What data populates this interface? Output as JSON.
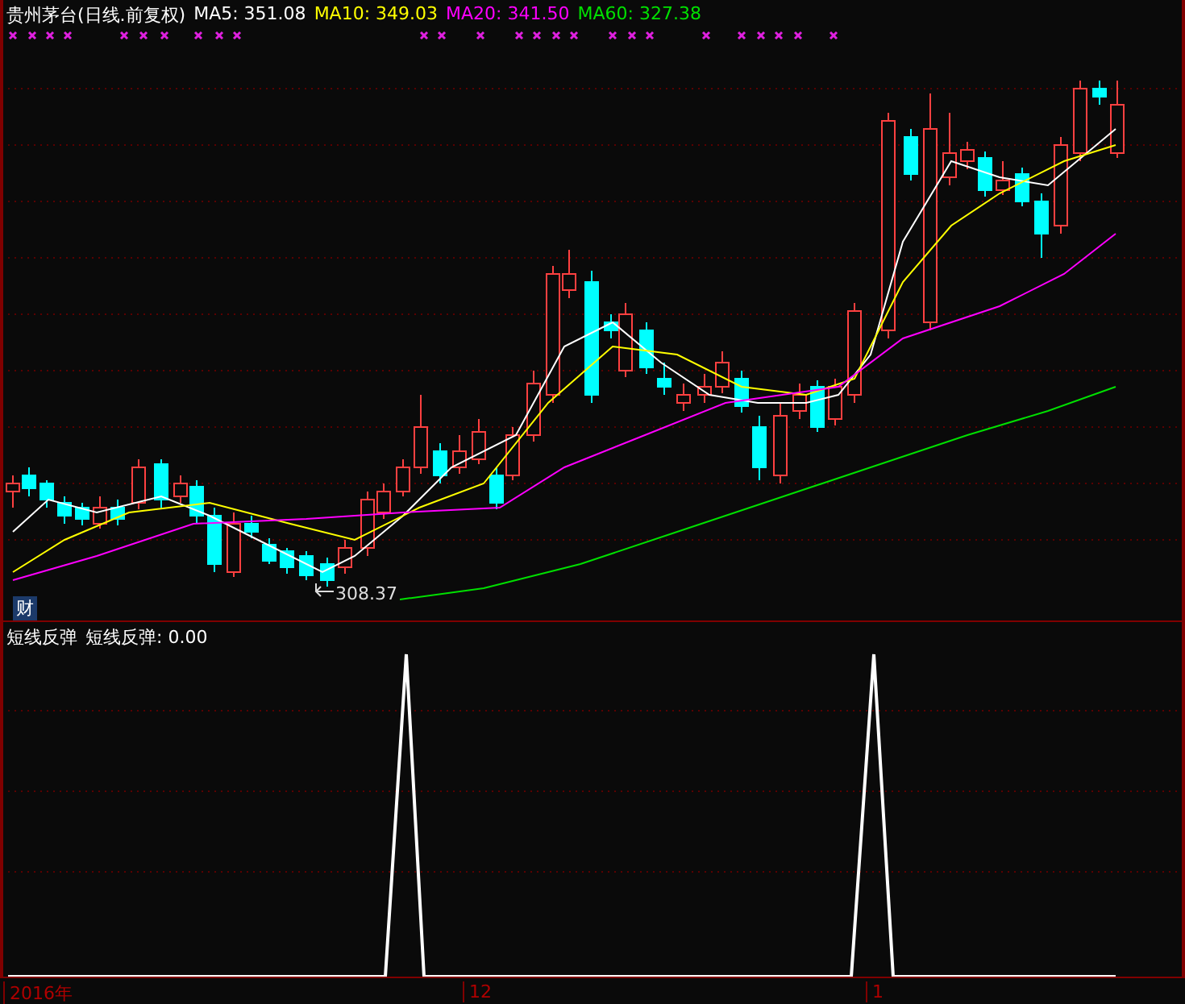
{
  "header": {
    "title": "贵州茅台(日线.前复权)",
    "indicators": [
      {
        "label": "MA5: 351.08",
        "color": "#ffffff"
      },
      {
        "label": "MA10: 349.03",
        "color": "#ffff00"
      },
      {
        "label": "MA20: 341.50",
        "color": "#ff00ff"
      },
      {
        "label": "MA60: 327.38",
        "color": "#00e000"
      }
    ]
  },
  "price_pane": {
    "low_label": "308.37",
    "badge": "财"
  },
  "indicator_pane": {
    "name": "短线反弹",
    "readout": "短线反弹: 0.00"
  },
  "time_axis": {
    "labels": [
      "2016年",
      "12",
      "1"
    ]
  }
}
